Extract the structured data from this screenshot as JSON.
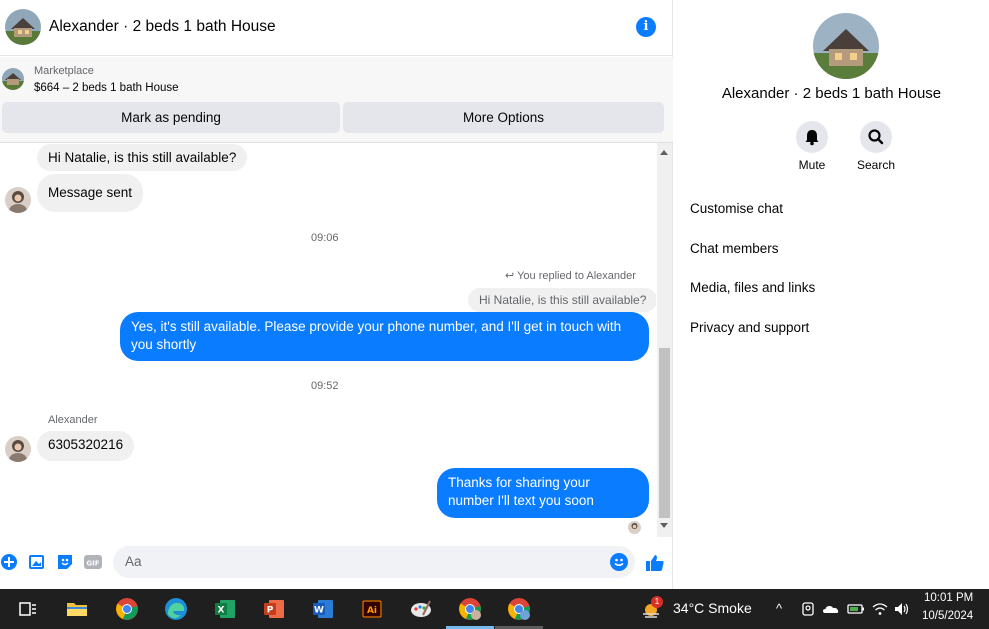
{
  "header": {
    "title": "Alexander · 2 beds 1 bath House",
    "info_icon": "info-icon"
  },
  "marketplace": {
    "label": "Marketplace",
    "listing": "$664 – 2 beds 1 bath House"
  },
  "actions": {
    "pending_label": "Mark as pending",
    "more_label": "More Options"
  },
  "messages": {
    "m1": "Hi Natalie, is this still available?",
    "m2": "Message sent",
    "time1": "09:06",
    "reply_note": "You replied to Alexander",
    "reply_quote": "Hi Natalie, is this still available?",
    "m3": "Yes, it's still available. Please provide your phone number, and I'll get in touch with you shortly",
    "time2": "09:52",
    "sender": "Alexander",
    "m4": "6305320216",
    "m5": "Thanks for sharing your number I'll text you soon"
  },
  "composer": {
    "placeholder": "Aa"
  },
  "right_panel": {
    "name": "Alexander · 2 beds 1 bath House",
    "mute_label": "Mute",
    "search_label": "Search",
    "items": [
      {
        "label": "Customise chat"
      },
      {
        "label": "Chat members"
      },
      {
        "label": "Media, files and links"
      },
      {
        "label": "Privacy and support"
      }
    ]
  },
  "taskbar": {
    "weather": "34°C  Smoke",
    "weather_badge": "1",
    "time": "10:01 PM",
    "date": "10/5/2024"
  },
  "colors": {
    "accent": "#0a7cff",
    "bubble_in": "#f0f0f0",
    "taskbar": "#1f1f1f"
  }
}
